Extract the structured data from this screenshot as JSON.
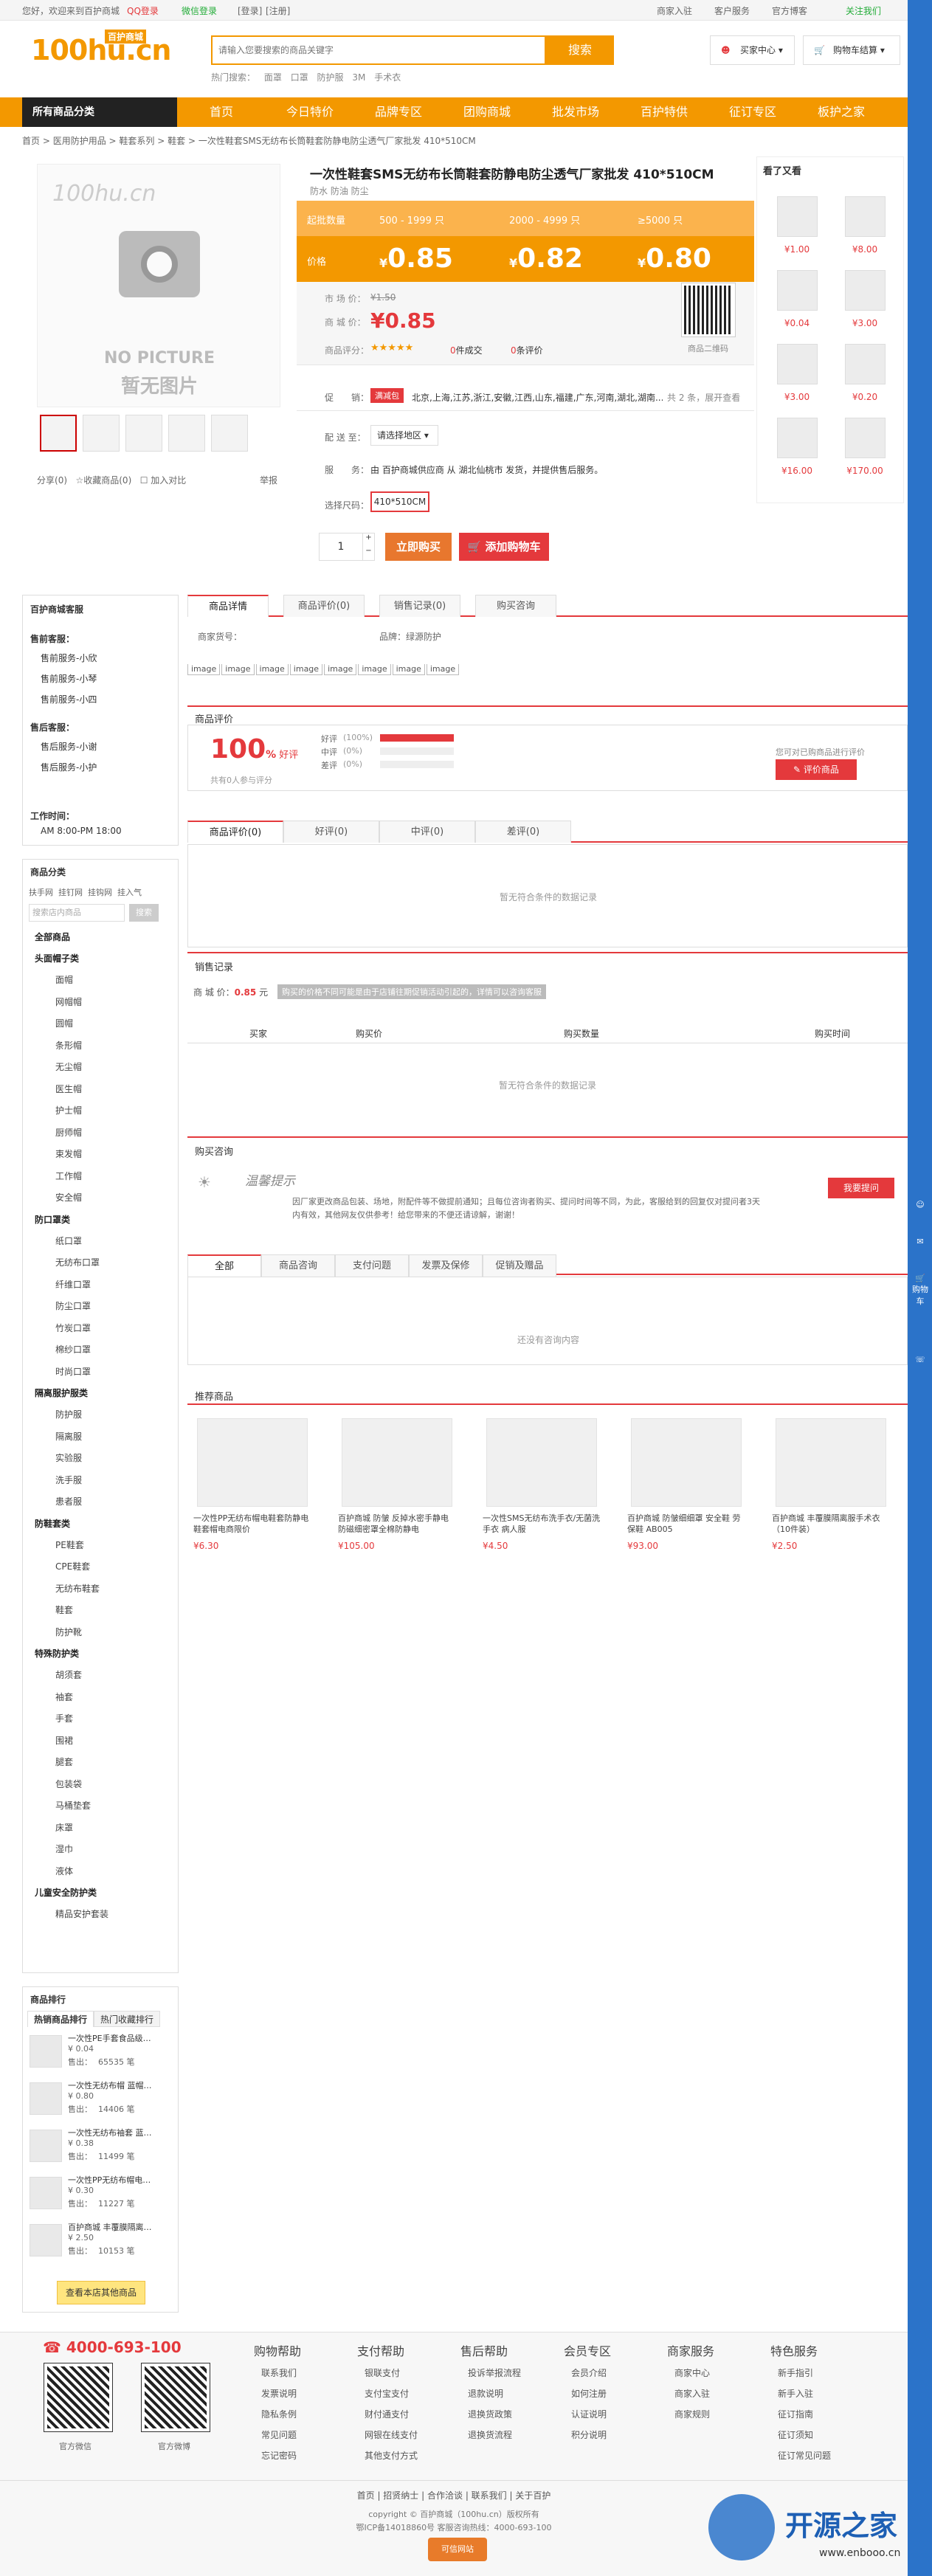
{
  "topbar": {
    "welcome": "您好，欢迎来到百护商城",
    "qq_login": "QQ登录",
    "wechat_login": "微信登录",
    "login": "[登录]",
    "register": "[注册]",
    "merchant": "商家入驻",
    "service": "客户服务",
    "official": "官方博客",
    "follow": "关注我们"
  },
  "header": {
    "logo_text": "100hu.cn",
    "logo_badge": "百护商城",
    "search_placeholder": "请输入您要搜索的商品关键字",
    "search_button": "搜索",
    "hot_label": "热门搜索：",
    "hot_words": [
      "面罩",
      "口罩",
      "防护服",
      "3M",
      "手术衣"
    ],
    "buyer_center": "买家中心",
    "cart": "购物车结算"
  },
  "nav": {
    "all_categories": "所有商品分类",
    "items": [
      "首页",
      "今日特价",
      "品牌专区",
      "团购商城",
      "批发市场",
      "百护特供",
      "征订专区",
      "板护之家"
    ]
  },
  "breadcrumb": [
    "首页",
    "医用防护用品",
    "鞋套系列",
    "鞋套",
    "一次性鞋套SMS无纺布长筒鞋套防静电防尘透气厂家批发 410*510CM"
  ],
  "gallery": {
    "no_pic_line1": "NO PICTURE",
    "no_pic_line2": "暂无图片",
    "watermark": "100hu.cn"
  },
  "product_actions": {
    "share": "分享",
    "share_count": "(0)",
    "favorite": "收藏商品",
    "favorite_count": "(0)",
    "compare": "加入对比",
    "report": "举报"
  },
  "product": {
    "title": "一次性鞋套SMS无纺布长筒鞋套防静电防尘透气厂家批发 410*510CM",
    "subtitle": "防水 防油 防尘",
    "qty_label": "起批数量",
    "price_label": "价格",
    "tiers": [
      {
        "range": "500 - 1999 只",
        "price": "0.85"
      },
      {
        "range": "2000 - 4999 只",
        "price": "0.82"
      },
      {
        "range": "≥5000 只",
        "price": "0.80"
      }
    ],
    "market_price_label": "市 场 价：",
    "market_price": "¥1.50",
    "mall_price_label": "商 城 价：",
    "mall_price": "¥0.85",
    "rating_label": "商品评分：",
    "deals": "0",
    "deals_label": "件成交",
    "reviews": "0",
    "reviews_label": "条评价",
    "qr_label": "商品二维码",
    "promo_label": "促　　销：",
    "promo_badge": "满减包",
    "promo_text": "北京,上海,江苏,浙江,安徽,江西,山东,福建,广东,河南,湖北,湖南...",
    "promo_more": "共 2 条，展开查看",
    "ship_label": "配 送 至：",
    "ship_select": "请选择地区",
    "service_label": "服　　务：",
    "service_text": "由 百护商城供应商 从 湖北仙桃市 发货，并提供售后服务。",
    "size_label": "选择尺码：",
    "size_value": "410*510CM",
    "quantity": "1",
    "buy_now": "立即购买",
    "add_cart": "添加购物车"
  },
  "viewed": {
    "title": "看了又看",
    "prices": [
      "¥1.00",
      "¥8.00",
      "¥0.04",
      "¥3.00",
      "¥3.00",
      "¥0.20",
      "¥16.00",
      "¥170.00"
    ]
  },
  "shop_service": {
    "title": "百护商城客服",
    "presale_label": "售前客服：",
    "presale": [
      "售前服务-小欣",
      "售前服务-小琴",
      "售前服务-小四"
    ],
    "aftersale_label": "售后客服：",
    "aftersale": [
      "售后服务-小谢",
      "售后服务-小护"
    ],
    "hours_label": "工作时间：",
    "hours": "AM 8:00-PM 18:00"
  },
  "category_panel": {
    "title": "商品分类",
    "tabs": [
      "扶手网",
      "挂钉网",
      "挂钩网",
      "挂入气"
    ],
    "search_placeholder": "搜索店内商品",
    "search_button": "搜索",
    "groups": [
      {
        "name": "全部商品",
        "items": []
      },
      {
        "name": "头面帽子类",
        "items": [
          "面帽",
          "网帽帽",
          "圆帽",
          "条形帽",
          "无尘帽",
          "医生帽",
          "护士帽",
          "厨师帽",
          "束发帽",
          "工作帽",
          "安全帽"
        ]
      },
      {
        "name": "防口罩类",
        "items": [
          "纸口罩",
          "无纺布口罩",
          "纤维口罩",
          "防尘口罩",
          "竹炭口罩",
          "棉纱口罩",
          "时尚口罩"
        ]
      },
      {
        "name": "隔离服护服类",
        "items": [
          "防护服",
          "隔离服",
          "实验服",
          "洗手服",
          "患者服"
        ]
      },
      {
        "name": "防鞋套类",
        "items": [
          "PE鞋套",
          "CPE鞋套",
          "无纺布鞋套",
          "鞋套",
          "防护靴"
        ]
      },
      {
        "name": "特殊防护类",
        "items": [
          "胡须套",
          "袖套",
          "手套",
          "围裙",
          "腿套",
          "包装袋",
          "马桶垫套",
          "床罩",
          "湿巾",
          "液体"
        ]
      },
      {
        "name": "儿童安全防护类",
        "items": [
          "精品安护套装"
        ]
      }
    ]
  },
  "ranking": {
    "title": "商品排行",
    "tabs": [
      "热销商品排行",
      "热门收藏排行"
    ],
    "items": [
      {
        "name": "一次性PE手套食品级…",
        "price": "¥ 0.04",
        "sold_label": "售出：",
        "sold": "65535 笔"
      },
      {
        "name": "一次性无纺布帽 蓝帽…",
        "price": "¥ 0.80",
        "sold_label": "售出：",
        "sold": "14406 笔"
      },
      {
        "name": "一次性无纺布袖套 蓝…",
        "price": "¥ 0.38",
        "sold_label": "售出：",
        "sold": "11499 笔"
      },
      {
        "name": "一次性PP无纺布帽电…",
        "price": "¥ 0.30",
        "sold_label": "售出：",
        "sold": "11227 笔"
      },
      {
        "name": "百护商城 丰覆膜隔离…",
        "price": "¥ 2.50",
        "sold_label": "售出：",
        "sold": "10153 笔"
      }
    ],
    "more": "查看本店其他商品"
  },
  "detail_tabs": [
    "商品详情",
    "商品评价(0)",
    "销售记录(0)",
    "购买咨询"
  ],
  "detail": {
    "item_no_label": "商家货号：",
    "brand_label": "品牌：",
    "brand": "绿源防护",
    "image_alt": "image"
  },
  "review": {
    "title": "商品评价",
    "percent": "100",
    "percent_unit": "%",
    "good_label": "好评",
    "participants": "共有0人参与评分",
    "rows": [
      {
        "label": "好评",
        "pct": "(100%)",
        "fill": 1.0
      },
      {
        "label": "中评",
        "pct": "(0%)",
        "fill": 0
      },
      {
        "label": "差评",
        "pct": "(0%)",
        "fill": 0
      }
    ],
    "cta_text": "您可对已购商品进行评价",
    "cta_button": "评价商品",
    "tabs": [
      "商品评价(0)",
      "好评(0)",
      "中评(0)",
      "差评(0)"
    ],
    "empty": "暂无符合条件的数据记录"
  },
  "sales": {
    "title": "销售记录",
    "price_label": "商 城 价：",
    "price": "0.85",
    "price_unit": "元",
    "note": "购买的价格不同可能是由于店铺往期促销活动引起的，详情可以咨询客服",
    "columns": [
      "买家",
      "购买价",
      "购买数量",
      "购买时间"
    ],
    "empty": "暂无符合条件的数据记录"
  },
  "consult": {
    "title": "购买咨询",
    "banner_title": "温馨提示",
    "notice": "因厂家更改商品包装、场地，附配件等不做提前通知；且每位咨询者购买、提问时间等不同，为此，客服给到的回复仅对提问者3天内有效，其他网友仅供参考！给您带来的不便还请谅解，谢谢！",
    "button": "我要提问",
    "tabs": [
      "全部",
      "商品咨询",
      "支付问题",
      "发票及保修",
      "促销及赠品"
    ],
    "empty": "还没有咨询内容"
  },
  "recommend": {
    "title": "推荐商品",
    "items": [
      {
        "name": "一次性PP无纺布帽电鞋套防静电鞋套帽电商限价",
        "price": "¥6.30"
      },
      {
        "name": "百护商城 防皱 反掉水密手静电 防磁细密罩全棉防静电",
        "price": "¥105.00"
      },
      {
        "name": "一次性SMS无纺布洗手衣/无菌洗手衣 病人服",
        "price": "¥4.50"
      },
      {
        "name": "百护商城 防皱细细罩 安全鞋 劳保鞋 AB005",
        "price": "¥93.00"
      },
      {
        "name": "百护商城 丰覆膜隔离服手术衣（10件装）",
        "price": "¥2.50"
      }
    ]
  },
  "footer": {
    "phone": "4000-693-100",
    "qr_labels": [
      "官方微信",
      "官方微博"
    ],
    "columns": [
      {
        "title": "购物帮助",
        "items": [
          "联系我们",
          "发票说明",
          "隐私条例",
          "常见问题",
          "忘记密码"
        ]
      },
      {
        "title": "支付帮助",
        "items": [
          "银联支付",
          "支付宝支付",
          "财付通支付",
          "网银在线支付",
          "其他支付方式"
        ]
      },
      {
        "title": "售后帮助",
        "items": [
          "投诉举报流程",
          "退款说明",
          "退换货政策",
          "退换货流程"
        ]
      },
      {
        "title": "会员专区",
        "items": [
          "会员介绍",
          "如何注册",
          "认证说明",
          "积分说明"
        ]
      },
      {
        "title": "商家服务",
        "items": [
          "商家中心",
          "商家入驻",
          "商家规则"
        ]
      },
      {
        "title": "特色服务",
        "items": [
          "新手指引",
          "新手入驻",
          "征订指南",
          "征订须知",
          "征订常见问题"
        ]
      }
    ],
    "links": [
      "首页",
      "招贤纳士",
      "合作洽谈",
      "联系我们",
      "关于百护"
    ],
    "copyright": "copyright © 百护商城（100hu.cn）版权所有",
    "icp": "鄂ICP备14018860号 客服咨询热线：4000-693-100",
    "badge": "可信网站"
  },
  "rightbar": [
    "购物车",
    "我的",
    "客服"
  ],
  "watermark": {
    "brand": "开源之家",
    "url": "www.enbooo.cn"
  },
  "colors": {
    "accent": "#f39800",
    "red": "#e4393c",
    "nav_dark": "#222222",
    "side_blue": "#2b73c9"
  }
}
